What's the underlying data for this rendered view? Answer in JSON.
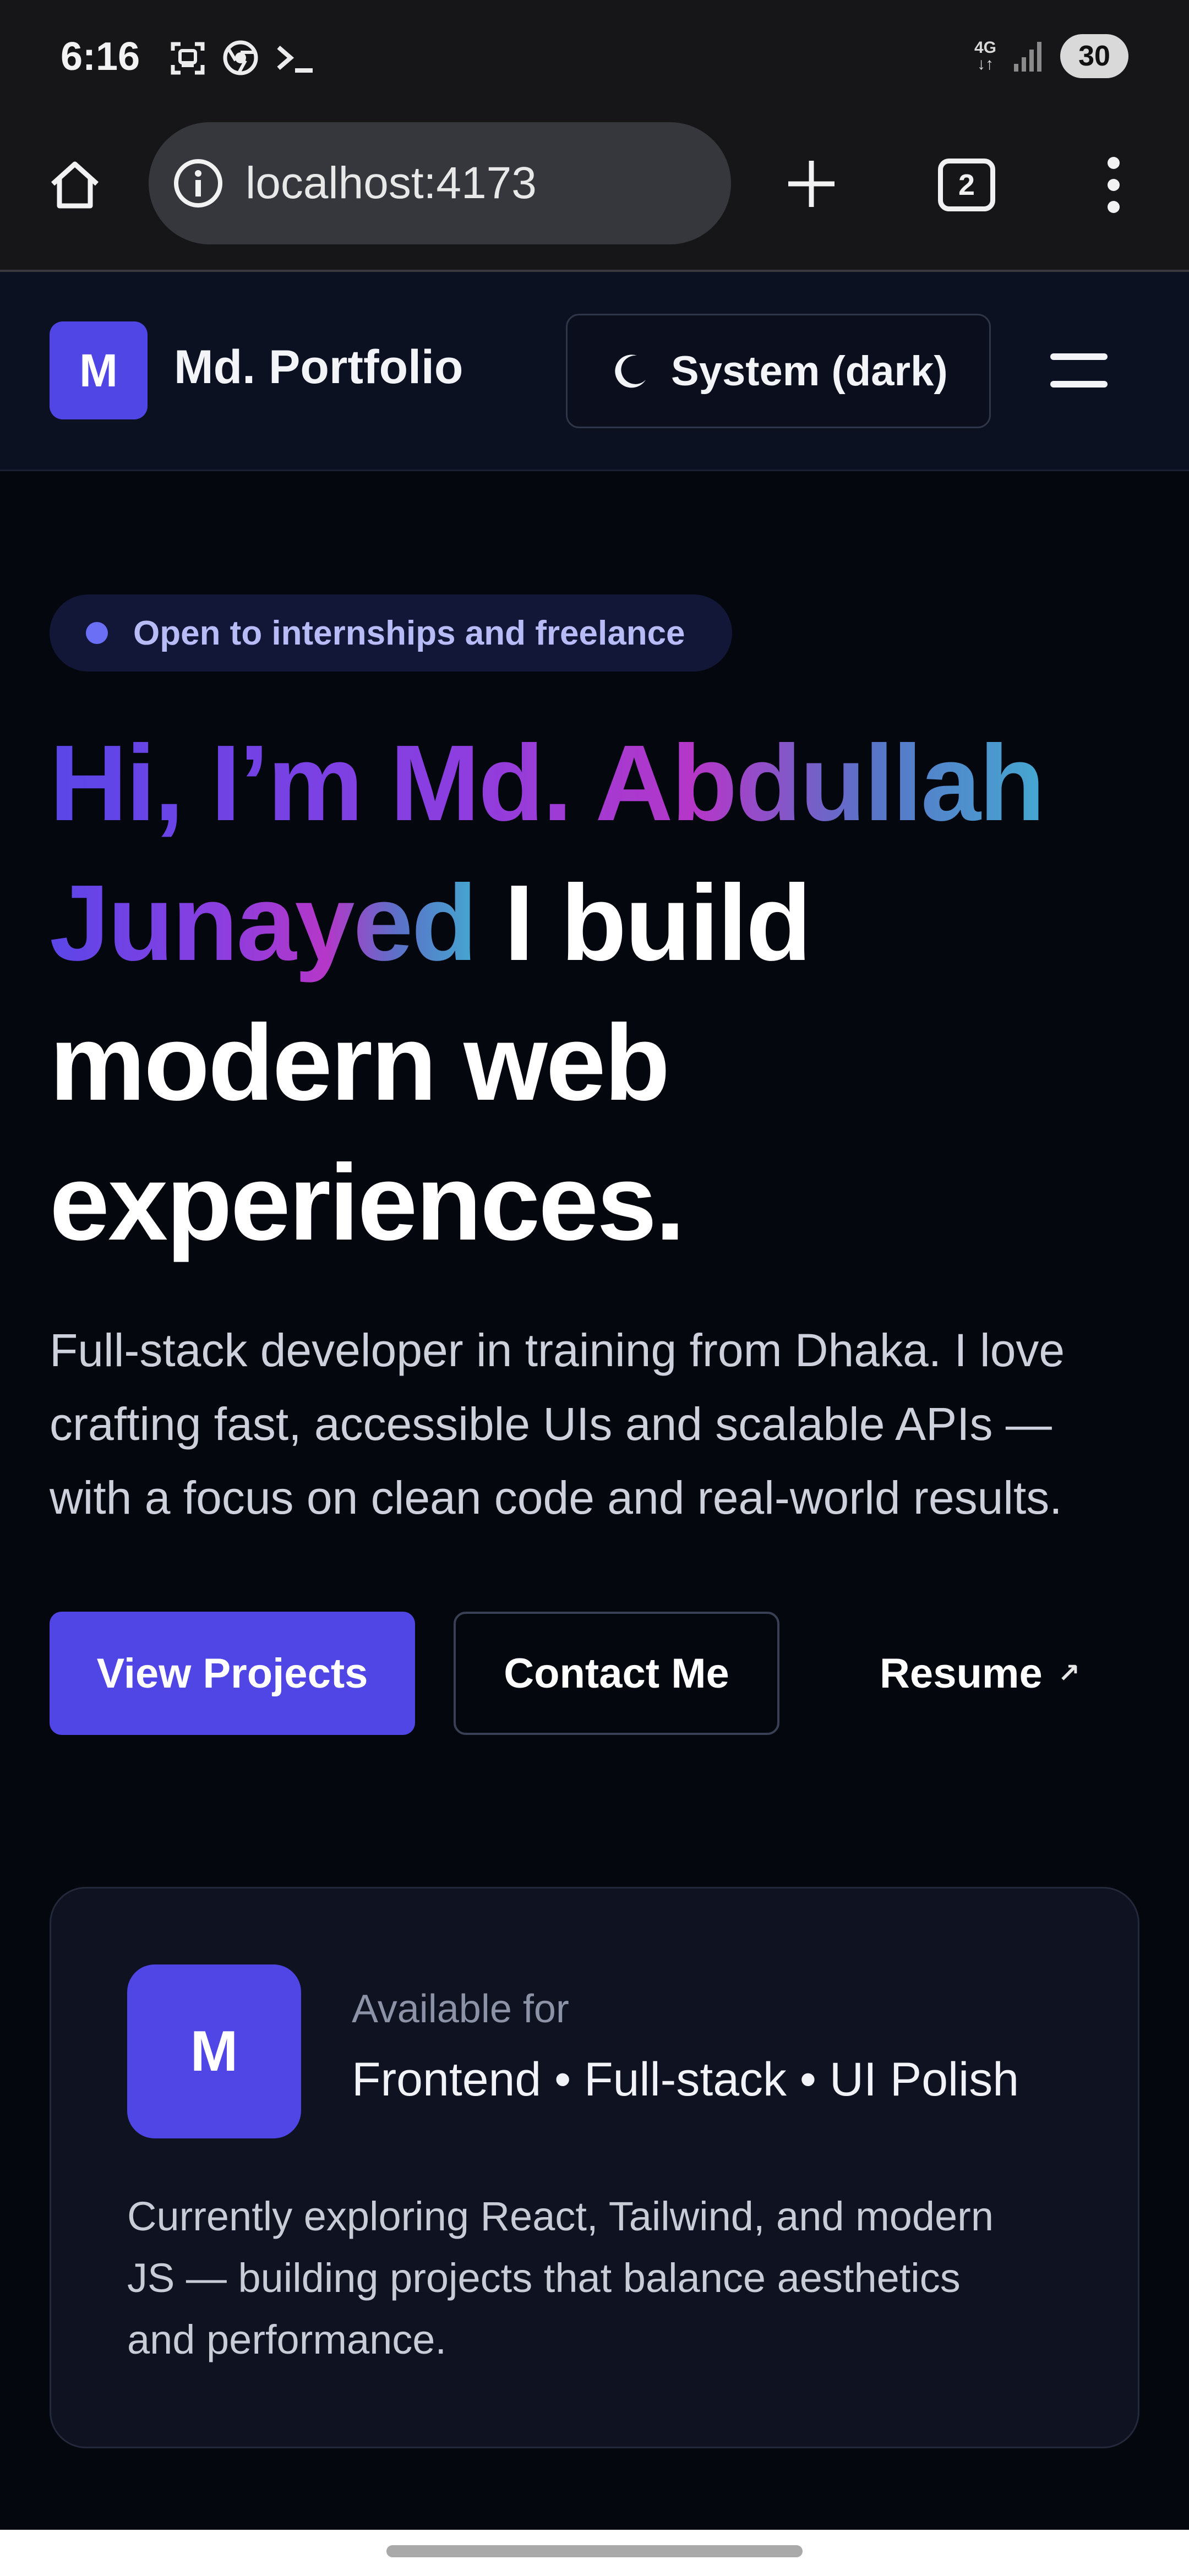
{
  "status_bar": {
    "time": "6:16",
    "network": "4G",
    "battery": "30",
    "left_icons": [
      "screenshot-icon",
      "chrome-icon",
      "terminal-icon"
    ],
    "right_icons": [
      "network-4g-icon",
      "signal-icon",
      "battery-icon"
    ]
  },
  "browser": {
    "url": "localhost:4173",
    "tab_count": "2",
    "icons": [
      "home-icon",
      "info-icon",
      "new-tab-icon",
      "tabs-icon",
      "overflow-menu-icon"
    ]
  },
  "header": {
    "logo_letter": "M",
    "brand": "Md. Portfolio",
    "theme_label": "System (dark)",
    "icons": [
      "moon-icon",
      "hamburger-menu-icon"
    ]
  },
  "hero": {
    "badge": "Open to internships and freelance",
    "greeting_line_1": "Hi, I’m Md. Abdullah",
    "greeting_line_2": "Junayed",
    "headline_rest_1": " I build",
    "headline_rest_2": "modern web",
    "headline_rest_3": "experiences.",
    "intro_line_1": "Full-stack developer in training from Dhaka. I love",
    "intro_line_2": "crafting fast, accessible UIs and scalable APIs —",
    "intro_line_3": "with a focus on clean code and real-world results.",
    "primary_cta": "View Projects",
    "secondary_cta": "Contact Me",
    "resume_link": "Resume",
    "resume_arrow": "↗"
  },
  "card": {
    "avatar_letter": "M",
    "kicker": "Available for",
    "title": "Frontend • Full-stack • UI Polish",
    "body_line_1": "Currently exploring React, Tailwind, and modern",
    "body_line_2": "JS — building projects that balance aesthetics",
    "body_line_3": "and performance."
  },
  "colors": {
    "accent": "#4f46e5",
    "page_background": "#05070f",
    "header_background": "#0c1121",
    "badge_text": "#b7bcf7"
  }
}
